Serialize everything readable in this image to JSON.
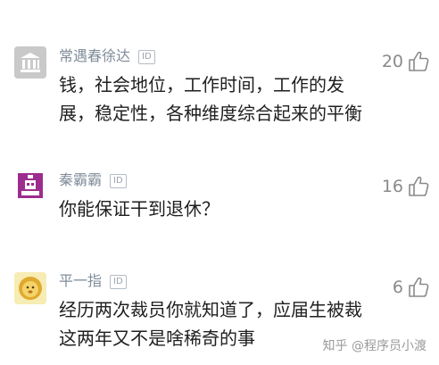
{
  "comments": [
    {
      "username": "常遇春徐达",
      "badge": "ID",
      "content": "钱，社会地位，工作时间，工作的发展，稳定性，各种维度综合起来的平衡",
      "likes": "20",
      "avatar_icon": "bank-building-icon"
    },
    {
      "username": "秦霸霸",
      "badge": "ID",
      "content": "你能保证干到退休？",
      "likes": "16",
      "avatar_icon": "pixel-robot-icon"
    },
    {
      "username": "平一指",
      "badge": "ID",
      "content": "经历两次裁员你就知道了，应届生被裁这两年又不是啥稀奇的事",
      "likes": "6",
      "avatar_icon": "cartoon-lion-icon"
    }
  ],
  "watermark": "知乎 @程序员小渡",
  "colors": {
    "username": "#7f8c99",
    "content": "#1f1f1f",
    "like": "#8a8a8a"
  }
}
